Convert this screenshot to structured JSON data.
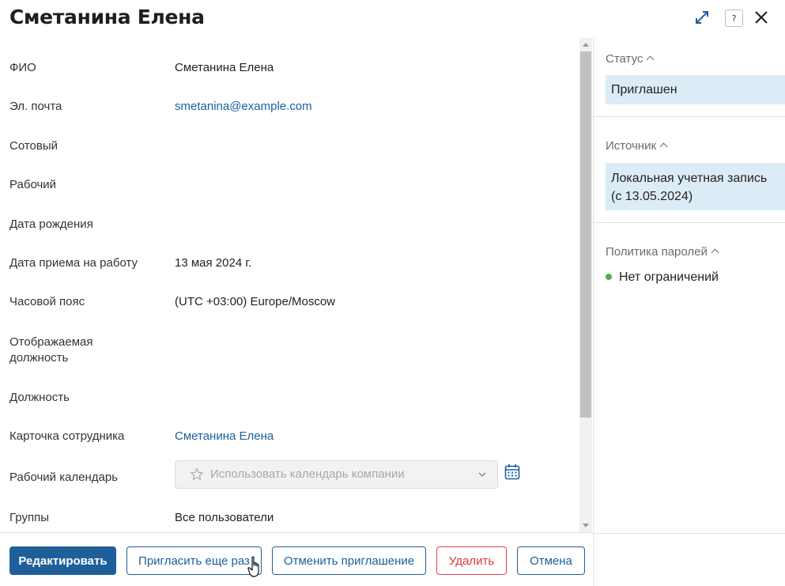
{
  "header": {
    "title": "Сметанина Елена",
    "help_label": "?"
  },
  "fields": {
    "fio": {
      "label": "ФИО",
      "value": "Сметанина Елена"
    },
    "email": {
      "label": "Эл. почта",
      "value": "smetanina@example.com"
    },
    "mobile": {
      "label": "Сотовый",
      "value": ""
    },
    "work": {
      "label": "Рабочий",
      "value": ""
    },
    "birthdate": {
      "label": "Дата рождения",
      "value": ""
    },
    "hire_date": {
      "label": "Дата приема на работу",
      "value": "13 мая 2024 г."
    },
    "timezone": {
      "label": "Часовой пояс",
      "value": "(UTC +03:00) Europe/Moscow"
    },
    "display_position": {
      "label": "Отображаемая должность",
      "value": ""
    },
    "position": {
      "label": "Должность",
      "value": ""
    },
    "employee_card": {
      "label": "Карточка сотрудника",
      "value": "Сметанина Елена"
    },
    "calendar": {
      "label": "Рабочий календарь",
      "placeholder": "Использовать календарь компании"
    },
    "groups": {
      "label": "Группы",
      "value": "Все пользователи"
    }
  },
  "sidebar": {
    "status": {
      "title": "Статус",
      "value": "Приглашен"
    },
    "source": {
      "title": "Источник",
      "value": "Локальная учетная запись (с 13.05.2024)"
    },
    "password_policy": {
      "title": "Политика паролей",
      "value": "Нет ограничений",
      "indicator_color": "#4caf50"
    }
  },
  "footer": {
    "edit": "Редактировать",
    "reinvite": "Пригласить еще раз",
    "cancel_invite": "Отменить приглашение",
    "delete": "Удалить",
    "cancel": "Отмена"
  },
  "colors": {
    "primary": "#1f5f99",
    "link": "#1b5f9e",
    "danger": "#d83a33",
    "sidebar_box": "#dcecf7"
  }
}
